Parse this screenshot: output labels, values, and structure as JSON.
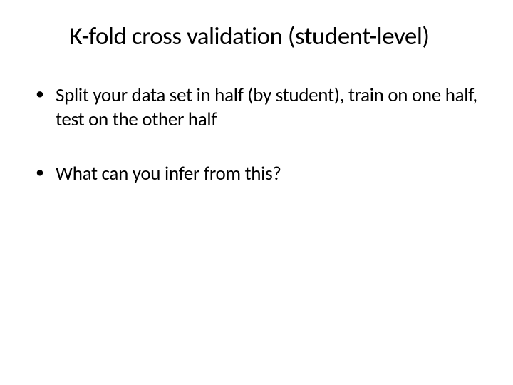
{
  "slide": {
    "title": "K-fold cross validation (student-level)",
    "bullets": [
      "Split your data set in half (by student), train on one half, test on the other half",
      "What can you infer from this?"
    ]
  }
}
